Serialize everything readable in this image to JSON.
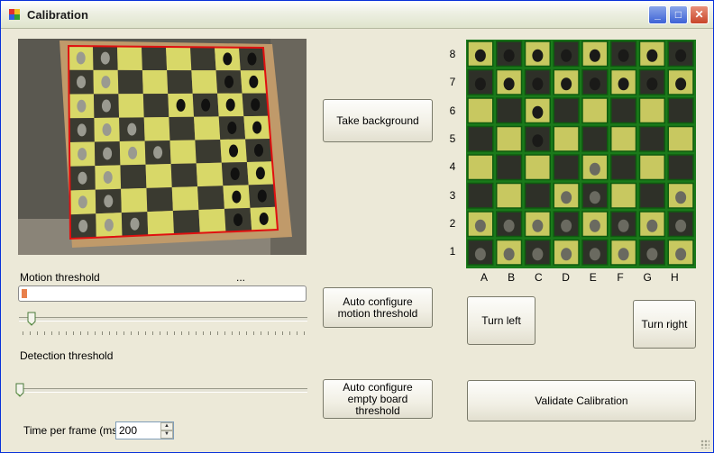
{
  "window": {
    "title": "Calibration",
    "minimize_symbol": "_",
    "maximize_symbol": "□",
    "close_symbol": "✕"
  },
  "buttons": {
    "take_background": "Take background",
    "auto_motion": "Auto configure motion threshold",
    "auto_empty": "Auto configure empty board threshold",
    "turn_left": "Turn left",
    "turn_right": "Turn right",
    "validate": "Validate Calibration"
  },
  "motion": {
    "label": "Motion threshold",
    "status": "...",
    "progress_fraction": 0.02,
    "slider_fraction": 0.03
  },
  "detection": {
    "label": "Detection threshold",
    "slider_fraction": 0.0
  },
  "time_per_frame": {
    "label": "Time per frame (ms)",
    "value": "200"
  },
  "board": {
    "ranks": [
      "8",
      "7",
      "6",
      "5",
      "4",
      "3",
      "2",
      "1"
    ],
    "files": [
      "A",
      "B",
      "C",
      "D",
      "E",
      "F",
      "G",
      "H"
    ],
    "pieces_rank_8": [
      "A",
      "B",
      "C",
      "D",
      "E",
      "F",
      "G",
      "H"
    ],
    "pieces_rank_7": [
      "A",
      "B",
      "C",
      "D",
      "E",
      "F",
      "G",
      "H"
    ],
    "pieces_rank_6": [
      "C"
    ],
    "pieces_rank_5": [
      "C"
    ],
    "pieces_rank_4": [
      "E"
    ],
    "pieces_rank_3": [
      "D",
      "E",
      "H"
    ],
    "pieces_rank_2": [
      "A",
      "B",
      "C",
      "D",
      "E",
      "F",
      "G",
      "H"
    ],
    "pieces_rank_1": [
      "A",
      "B",
      "C",
      "D",
      "E",
      "F",
      "G",
      "H"
    ]
  },
  "colors": {
    "light_square": "#c8c860",
    "dark_square": "#2e3028",
    "grid_border": "#1a7a1a",
    "camera_border": "#e01010",
    "progress_fill": "#e8804c"
  }
}
